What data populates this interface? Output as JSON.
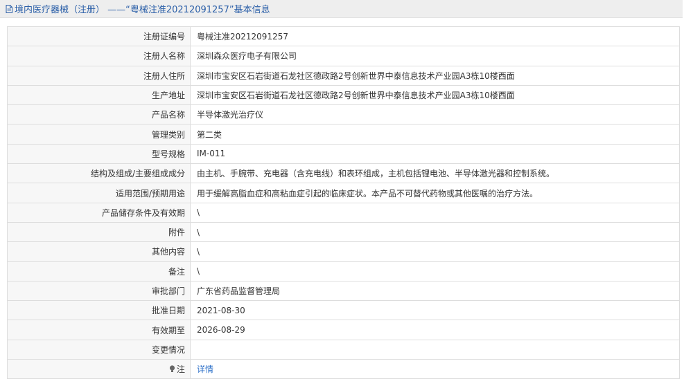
{
  "header": {
    "title": "境内医疗器械（注册） ——“粤械注准20212091257”基本信息"
  },
  "rows": [
    {
      "label": "注册证编号",
      "value": "粤械注准20212091257"
    },
    {
      "label": "注册人名称",
      "value": "深圳森众医疗电子有限公司"
    },
    {
      "label": "注册人住所",
      "value": "深圳市宝安区石岩街道石龙社区德政路2号创新世界中泰信息技术产业园A3栋10楼西面"
    },
    {
      "label": "生产地址",
      "value": "深圳市宝安区石岩街道石龙社区德政路2号创新世界中泰信息技术产业园A3栋10楼西面"
    },
    {
      "label": "产品名称",
      "value": "半导体激光治疗仪"
    },
    {
      "label": "管理类别",
      "value": "第二类"
    },
    {
      "label": "型号规格",
      "value": "IM-011"
    },
    {
      "label": "结构及组成/主要组成成分",
      "value": "由主机、手腕带、充电器（含充电线）和表环组成，主机包括锂电池、半导体激光器和控制系统。"
    },
    {
      "label": "适用范围/预期用途",
      "value": "用于缓解高脂血症和高粘血症引起的临床症状。本产品不可替代药物或其他医嘱的治疗方法。"
    },
    {
      "label": "产品储存条件及有效期",
      "value": "\\"
    },
    {
      "label": "附件",
      "value": "\\"
    },
    {
      "label": "其他内容",
      "value": "\\"
    },
    {
      "label": "备注",
      "value": "\\"
    },
    {
      "label": "审批部门",
      "value": "广东省药品监督管理局"
    },
    {
      "label": "批准日期",
      "value": "2021-08-30"
    },
    {
      "label": "有效期至",
      "value": "2026-08-29"
    },
    {
      "label": "变更情况",
      "value": ""
    }
  ],
  "note_row": {
    "label": "注",
    "link_text": "详情",
    "icon": "lightbulb-icon"
  },
  "colors": {
    "title_text": "#2b5fa8",
    "link": "#2b6fc8",
    "label_bg": "#f7f7f7",
    "border": "#dddddd"
  }
}
